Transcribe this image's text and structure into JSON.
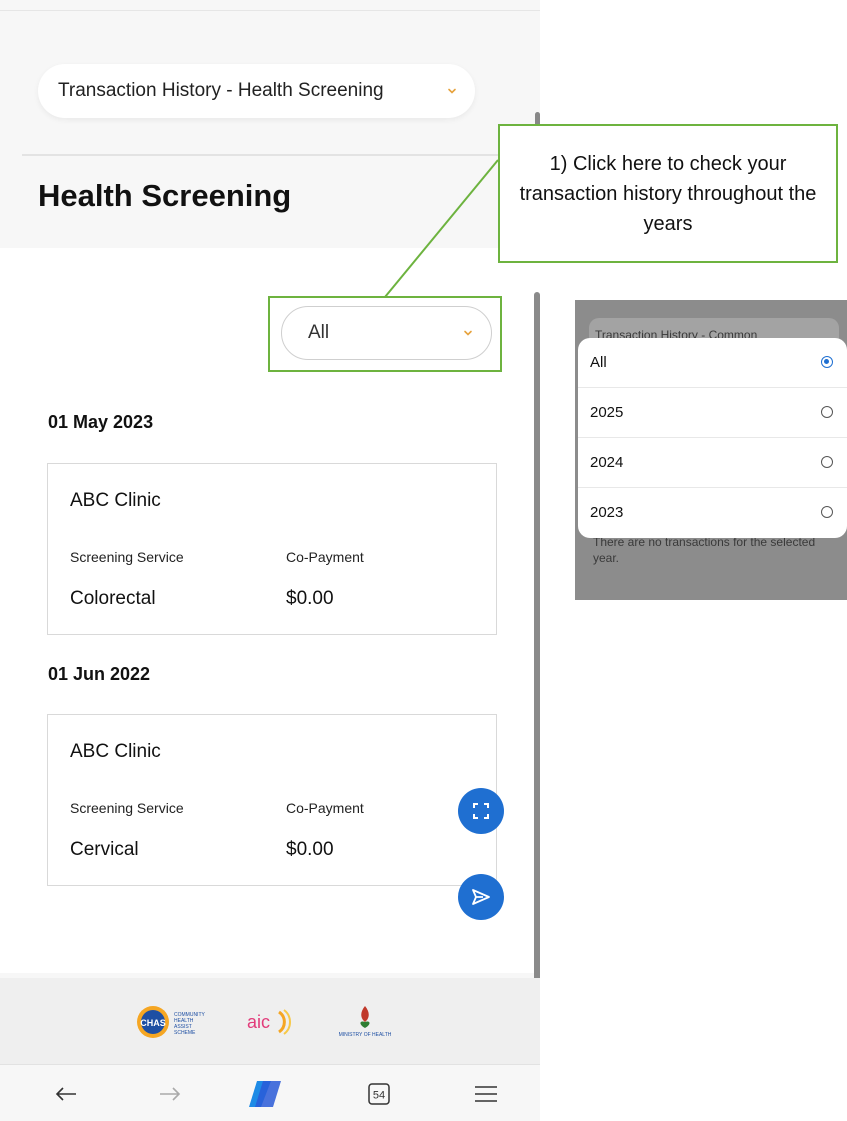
{
  "header": {
    "dropdown_label": "Transaction History - Health Screening",
    "page_title": "Health Screening"
  },
  "filter": {
    "selected": "All"
  },
  "transactions": [
    {
      "date": "01 May 2023",
      "clinic": "ABC Clinic",
      "service_header": "Screening Service",
      "payment_header": "Co-Payment",
      "service": "Colorectal",
      "copayment": "$0.00"
    },
    {
      "date": "01 Jun 2022",
      "clinic": "ABC Clinic",
      "service_header": "Screening Service",
      "payment_header": "Co-Payment",
      "service": "Cervical",
      "copayment": "$0.00"
    }
  ],
  "callout": {
    "text": "1) Click here to check your transaction history throughout the years"
  },
  "year_picker": {
    "background_title": "Transaction History - Common",
    "background_message": "There are no transactions for the selected year.",
    "options": [
      {
        "label": "All",
        "selected": true
      },
      {
        "label": "2025",
        "selected": false
      },
      {
        "label": "2024",
        "selected": false
      },
      {
        "label": "2023",
        "selected": false
      }
    ]
  },
  "footer": {
    "logos": [
      {
        "name": "chas-logo",
        "text": "CHAS",
        "subtext": "COMMUNITY HEALTH ASSIST SCHEME"
      },
      {
        "name": "aic-logo",
        "text": "aic"
      },
      {
        "name": "moh-logo",
        "text": "MINISTRY OF HEALTH"
      }
    ]
  },
  "navbar": {
    "tabs_count": "54"
  },
  "colors": {
    "accent": "#1f6fd1",
    "callout_border": "#6db33f",
    "chevron": "#e6a23c"
  }
}
